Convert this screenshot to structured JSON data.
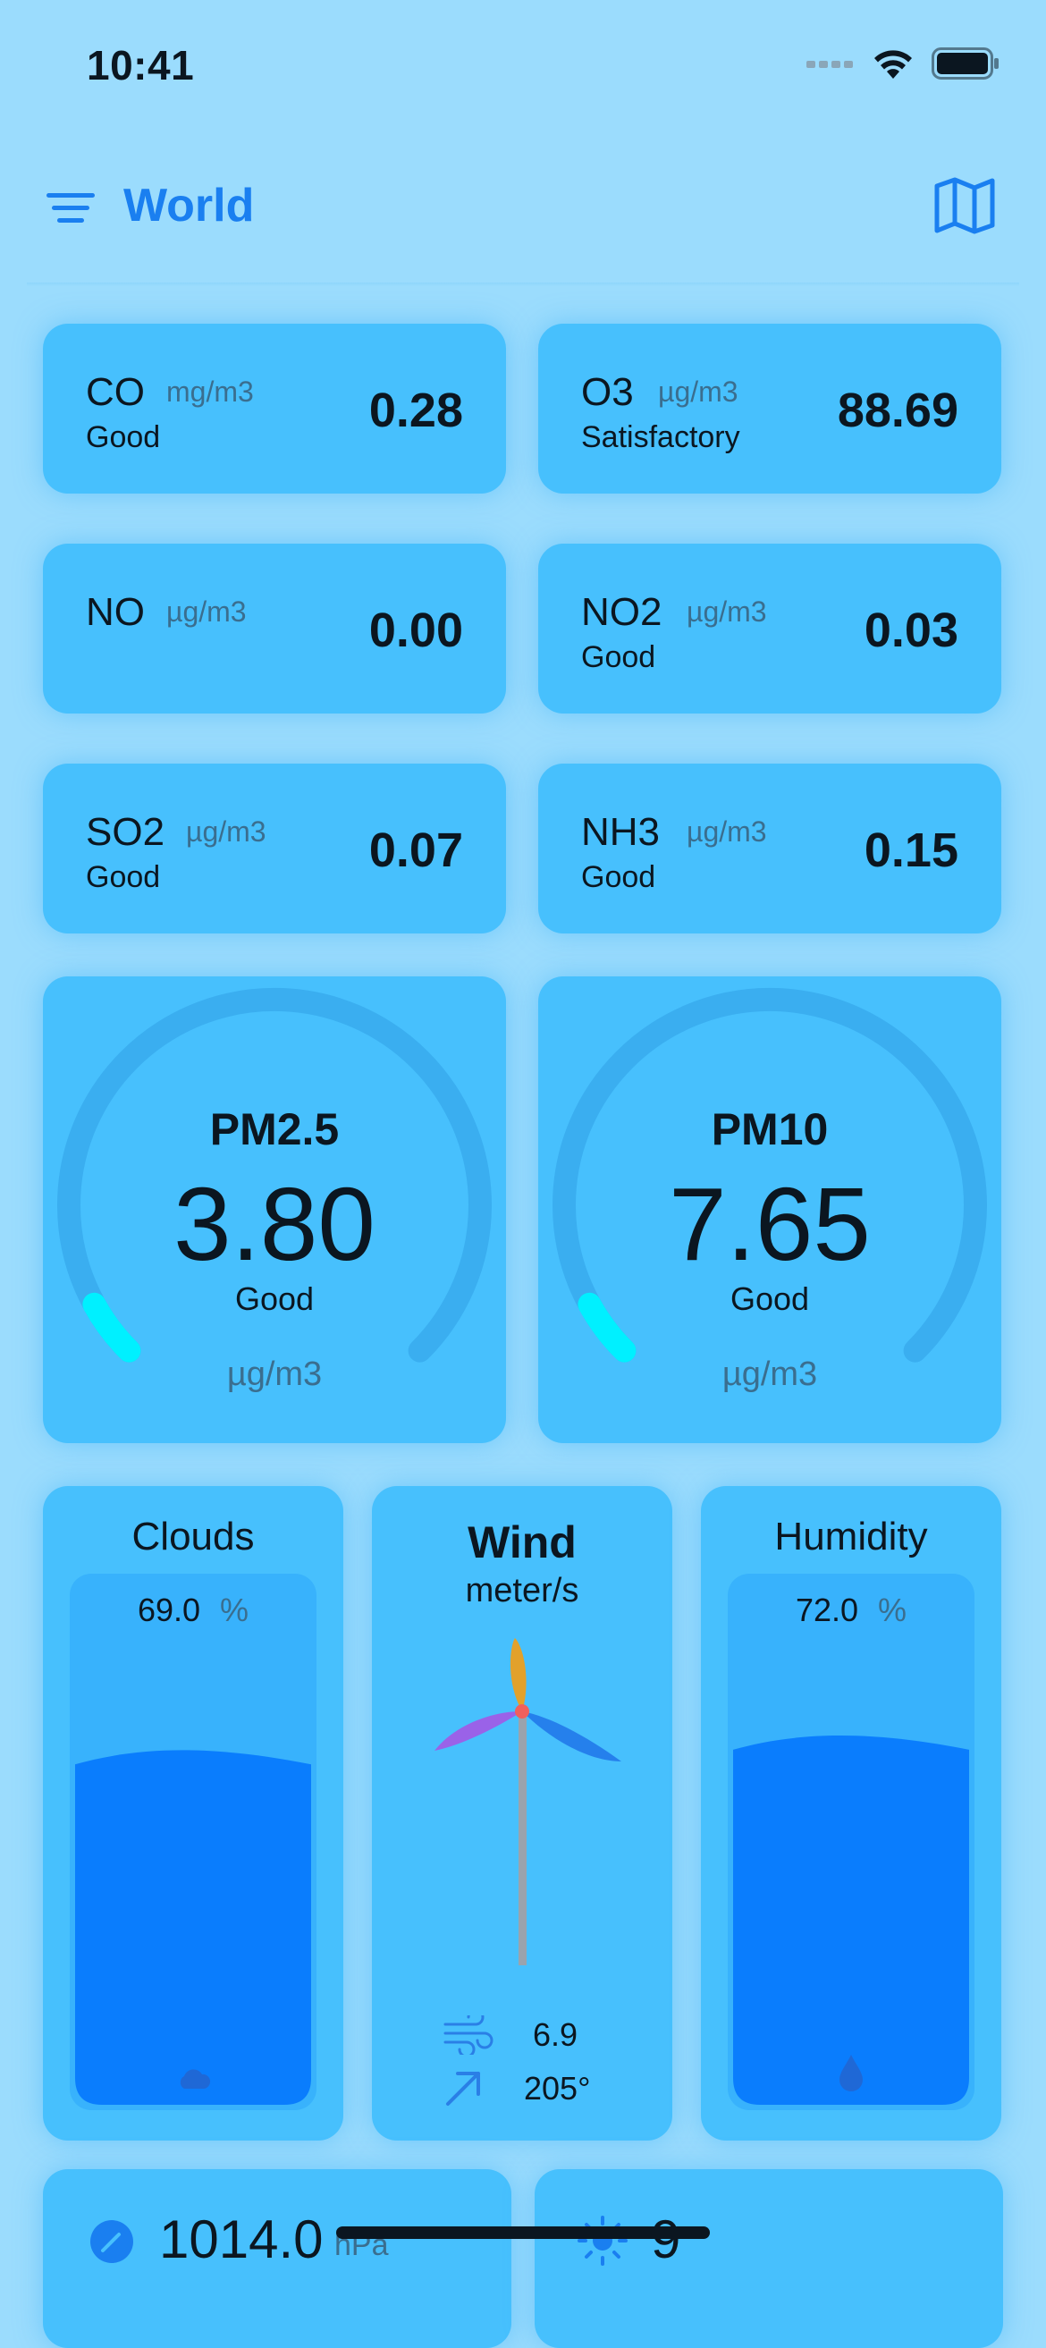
{
  "status_bar": {
    "time": "10:41"
  },
  "nav": {
    "title": "World"
  },
  "gases": [
    {
      "name": "CO",
      "unit": "mg/m3",
      "status": "Good",
      "value": "0.28"
    },
    {
      "name": "O3",
      "unit": "µg/m3",
      "status": "Satisfactory",
      "value": "88.69"
    },
    {
      "name": "NO",
      "unit": "µg/m3",
      "status": "",
      "value": "0.00"
    },
    {
      "name": "NO2",
      "unit": "µg/m3",
      "status": "Good",
      "value": "0.03"
    },
    {
      "name": "SO2",
      "unit": "µg/m3",
      "status": "Good",
      "value": "0.07"
    },
    {
      "name": "NH3",
      "unit": "µg/m3",
      "status": "Good",
      "value": "0.15"
    }
  ],
  "pm": [
    {
      "name": "PM2.5",
      "value": "3.80",
      "status": "Good",
      "unit": "µg/m3",
      "level": 0.06
    },
    {
      "name": "PM10",
      "value": "7.65",
      "status": "Good",
      "unit": "µg/m3",
      "level": 0.06
    }
  ],
  "clouds": {
    "title": "Clouds",
    "value": "69.0",
    "unit": "%",
    "level": 0.69
  },
  "wind": {
    "title": "Wind",
    "unit": "meter/s",
    "speed": "6.9",
    "direction": "205°"
  },
  "humidity": {
    "title": "Humidity",
    "value": "72.0",
    "unit": "%",
    "level": 0.72
  },
  "bottom": {
    "pressure_value": "1014.0",
    "pressure_unit": "hPa",
    "uv_value": "9"
  },
  "colors": {
    "accent": "#1a7ff0",
    "card": "#47c0fd",
    "water": "#0a7dfd",
    "gauge": "#00f0ff"
  }
}
